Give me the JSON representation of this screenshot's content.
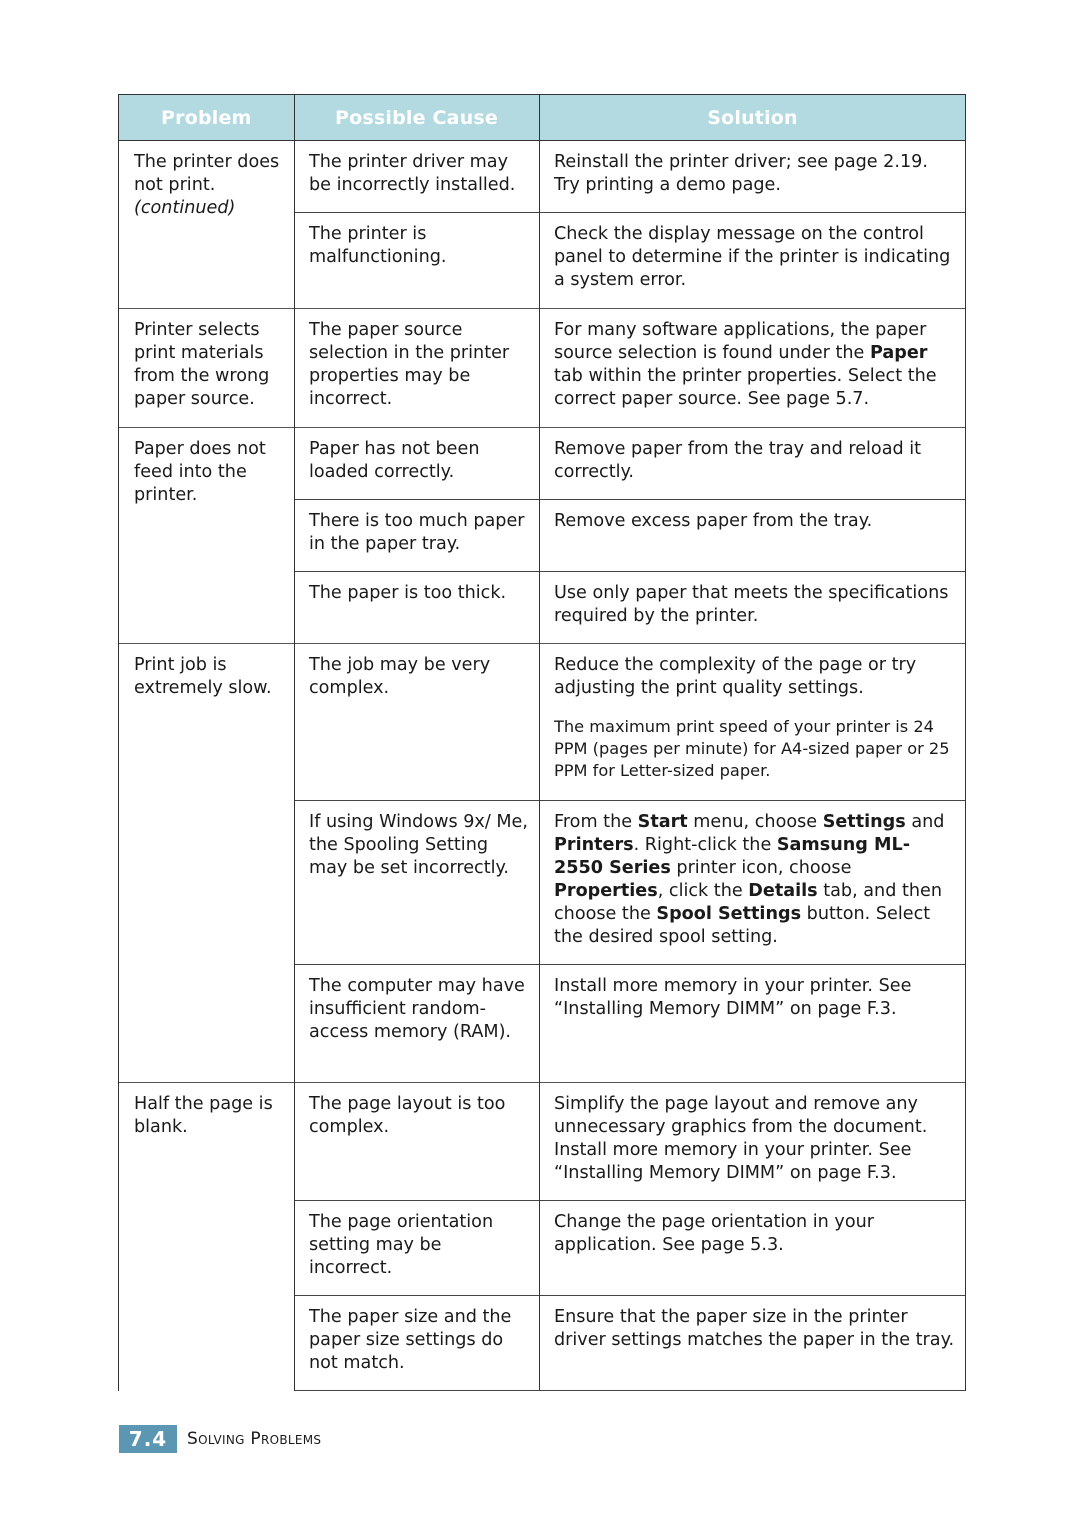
{
  "table": {
    "headers": {
      "problem": "Problem",
      "cause": "Possible Cause",
      "solution": "Solution"
    },
    "rows": [
      {
        "problem": "The printer does not print.",
        "problem_note": "(continued)",
        "causes": [
          {
            "cause": "The printer driver may be incorrectly installed.",
            "solution": "Reinstall the printer driver; see page 2.19. Try printing a demo page."
          },
          {
            "cause": "The printer is malfunctioning.",
            "solution": "Check the display message on the control panel to determine if the printer is indicating a system error."
          }
        ]
      },
      {
        "problem": "Printer selects print materials from the wrong paper source.",
        "causes": [
          {
            "cause": "The paper source selection in the printer properties may be incorrect.",
            "solution_parts": [
              {
                "text": "For many software applications, the paper source selection is found under the ",
                "bold": false
              },
              {
                "text": "Paper",
                "bold": true
              },
              {
                "text": " tab within the printer properties. Select the correct paper source. See page 5.7.",
                "bold": false
              }
            ]
          }
        ]
      },
      {
        "problem": "Paper does not feed into the printer.",
        "causes": [
          {
            "cause": "Paper has not been loaded correctly.",
            "solution": "Remove paper from the tray and reload it correctly."
          },
          {
            "cause": "There is too much paper in the paper tray.",
            "solution": "Remove excess paper from the tray."
          },
          {
            "cause": "The paper is too thick.",
            "solution": "Use only paper that meets the specifications required by the printer."
          }
        ]
      },
      {
        "problem": "Print job is extremely slow.",
        "causes": [
          {
            "cause": "The job may be very complex.",
            "solution": "Reduce the complexity of the page or try adjusting the print quality settings.",
            "note": "The maximum print speed of your printer is 24 PPM (pages per minute) for A4-sized paper or 25 PPM for Letter-sized paper."
          },
          {
            "cause": "If using Windows 9x/ Me, the Spooling Setting may be set incorrectly.",
            "solution_parts": [
              {
                "text": "From the ",
                "bold": false
              },
              {
                "text": "Start",
                "bold": true
              },
              {
                "text": " menu, choose ",
                "bold": false
              },
              {
                "text": "Settings",
                "bold": true
              },
              {
                "text": " and ",
                "bold": false
              },
              {
                "text": "Printers",
                "bold": true
              },
              {
                "text": ". Right-click the ",
                "bold": false
              },
              {
                "text": "Samsung ML-2550 Series",
                "bold": true
              },
              {
                "text": " printer icon, choose ",
                "bold": false
              },
              {
                "text": "Properties",
                "bold": true
              },
              {
                "text": ", click the ",
                "bold": false
              },
              {
                "text": "Details",
                "bold": true
              },
              {
                "text": " tab, and then choose the ",
                "bold": false
              },
              {
                "text": "Spool Settings",
                "bold": true
              },
              {
                "text": " button. Select the desired spool setting.",
                "bold": false
              }
            ]
          },
          {
            "cause": "The computer may have insufficient random-access memory (RAM).",
            "solution": "Install more memory in your printer. See “Installing Memory DIMM” on page F.3."
          }
        ]
      },
      {
        "problem": "Half the page is blank.",
        "causes": [
          {
            "cause": "The page layout is too complex.",
            "solution": "Simplify the page layout and remove any unnecessary graphics from the document. Install more memory in your printer. See “Installing Memory DIMM” on page F.3."
          },
          {
            "cause": "The page orientation setting may be incorrect.",
            "solution": "Change the page orientation in your application. See page 5.3."
          },
          {
            "cause": "The paper size and the paper size settings do not match.",
            "solution": "Ensure that the paper size in the printer driver settings matches the paper in the tray."
          }
        ]
      }
    ]
  },
  "footer": {
    "page_number": "7.4",
    "section_title": "Solving Problems"
  },
  "colors": {
    "header_background": "#b2dae0",
    "header_text": "#ffffff",
    "page_badge": "#5b97b2"
  }
}
